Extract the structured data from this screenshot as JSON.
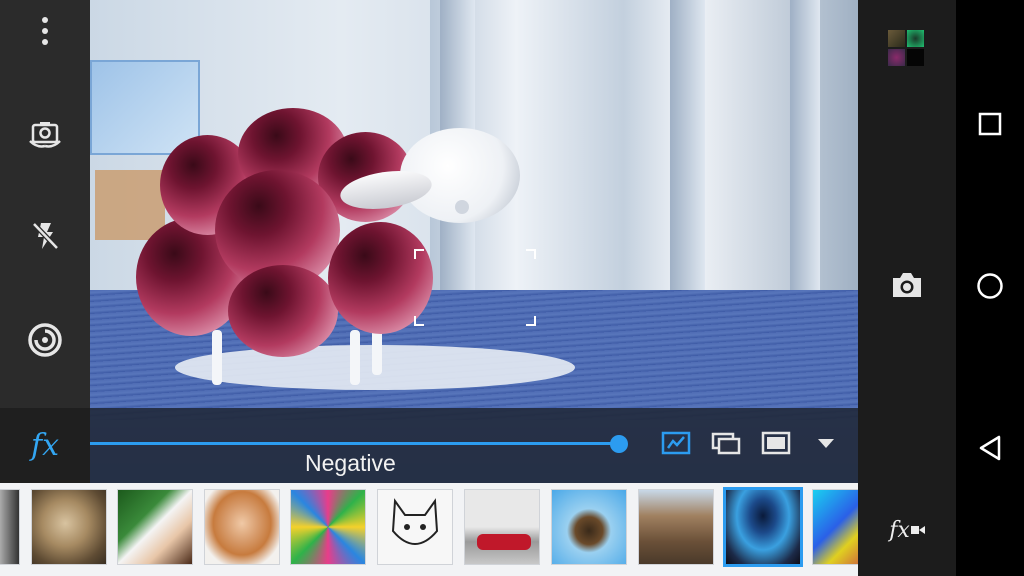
{
  "app": {
    "effect": {
      "name": "Negative",
      "intensity_percent": 100
    },
    "left_controls": {
      "icons": [
        "overflow-menu-icon",
        "switch-camera-icon",
        "flash-off-icon",
        "focus-mode-icon",
        "fx-icon"
      ],
      "fx_label": "fx"
    },
    "effect_bar": {
      "icons": [
        "auto-enhance-icon",
        "frame-overlay-icon",
        "aspect-frame-icon",
        "expand-down-icon"
      ],
      "accent_color": "#2c9cf0"
    },
    "filters": {
      "selected_index": 9,
      "items": [
        "filter-partial",
        "filter-kitten",
        "filter-woman-letter",
        "filter-surprised-woman",
        "filter-mandala",
        "filter-cat-sketch",
        "filter-vintage-car",
        "filter-tiny-planet",
        "filter-rocky-beach",
        "filter-negative",
        "filter-psychedelic"
      ]
    },
    "right_controls": {
      "icons": [
        "recent-photos-icon",
        "shutter-camera-icon",
        "fx-video-icon"
      ],
      "fx_video_label": "fx"
    },
    "system_nav": {
      "icons": [
        "recents-square-icon",
        "home-circle-icon",
        "back-triangle-icon"
      ]
    }
  }
}
